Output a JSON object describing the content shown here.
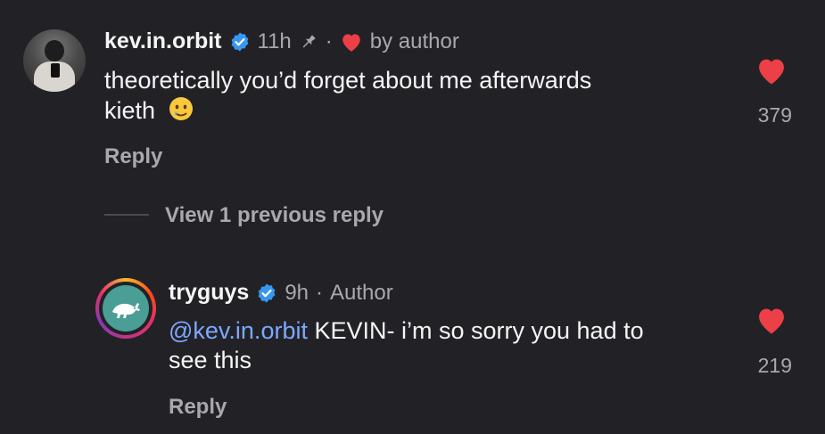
{
  "comments": [
    {
      "username": "kev.in.orbit",
      "time": "11h",
      "dot": "·",
      "by_author": "by author",
      "text_line1": "theoretically you’d forget about me afterwards",
      "text_line2": "kieth",
      "emoji": "🥲",
      "likes": "379",
      "reply_label": "Reply",
      "icons": [
        "verified-badge-icon",
        "pin-icon",
        "heart-icon"
      ]
    }
  ],
  "view_previous": "View 1 previous reply",
  "reply": {
    "username": "tryguys",
    "time": "9h",
    "dot": "·",
    "author_label": "Author",
    "mention": "@kev.in.orbit",
    "text_line1": " KEVIN- i’m so sorry you had to",
    "text_line2": "see this",
    "likes": "219",
    "reply_label": "Reply"
  },
  "colors": {
    "background": "#222226",
    "verified": "#3897f0",
    "heart": "#ed3f47",
    "mention": "#7ea7ff",
    "secondary_text": "#a8a8ad"
  }
}
